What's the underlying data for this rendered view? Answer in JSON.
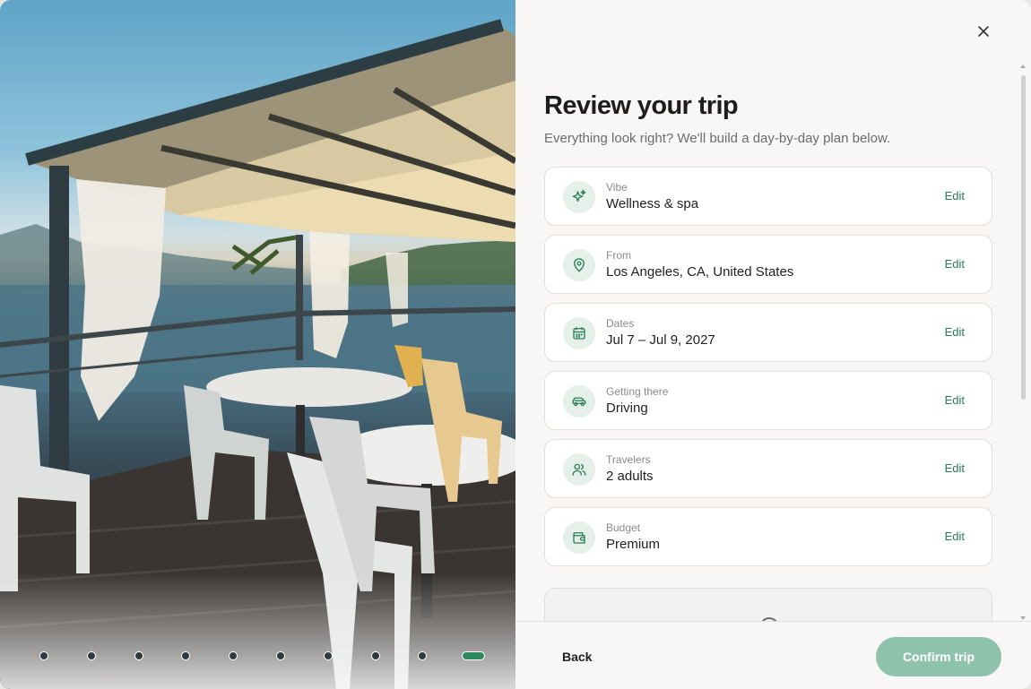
{
  "dialog": {
    "title": "Review your trip",
    "subtitle": "Everything look right? We'll build a day-by-day plan below.",
    "close_icon": "close-icon"
  },
  "summary": [
    {
      "icon": "sparkles-icon",
      "label": "Vibe",
      "value": "Wellness & spa",
      "edit": "Edit"
    },
    {
      "icon": "map-pin-icon",
      "label": "From",
      "value": "Los Angeles, CA, United States",
      "edit": "Edit"
    },
    {
      "icon": "calendar-icon",
      "label": "Dates",
      "value": "Jul 7 – Jul 9, 2027",
      "edit": "Edit"
    },
    {
      "icon": "car-icon",
      "label": "Getting there",
      "value": "Driving",
      "edit": "Edit"
    },
    {
      "icon": "users-icon",
      "label": "Travelers",
      "value": "2 adults",
      "edit": "Edit"
    },
    {
      "icon": "wallet-icon",
      "label": "Budget",
      "value": "Premium",
      "edit": "Edit"
    }
  ],
  "carousel": {
    "total_dots": 10,
    "active_index": 9
  },
  "footer": {
    "back_label": "Back",
    "confirm_label": "Confirm trip"
  },
  "colors": {
    "accent": "#2c7d56",
    "icon_bg": "#e6f0ea",
    "confirm_bg": "#8fc2ad",
    "panel_bg": "#f8f7f5"
  }
}
